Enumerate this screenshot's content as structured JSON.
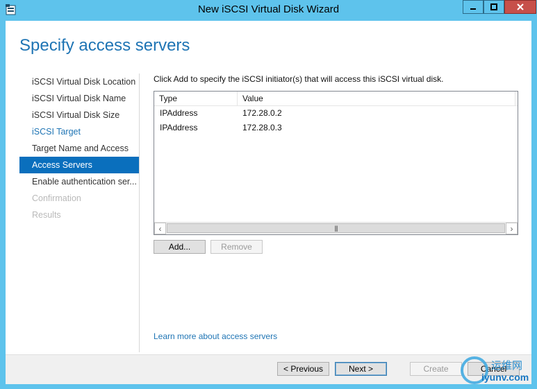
{
  "window": {
    "title": "New iSCSI Virtual Disk Wizard",
    "app_icon": "wizard-app-icon",
    "controls": [
      "minimize-icon",
      "maximize-icon",
      "close-icon"
    ]
  },
  "page": {
    "heading": "Specify access servers"
  },
  "nav": {
    "items": [
      {
        "label": "iSCSI Virtual Disk Location",
        "state": "normal"
      },
      {
        "label": "iSCSI Virtual Disk Name",
        "state": "normal"
      },
      {
        "label": "iSCSI Virtual Disk Size",
        "state": "normal"
      },
      {
        "label": "iSCSI Target",
        "state": "link"
      },
      {
        "label": "Target Name and Access",
        "state": "normal"
      },
      {
        "label": "Access Servers",
        "state": "active"
      },
      {
        "label": "Enable authentication ser...",
        "state": "normal"
      },
      {
        "label": "Confirmation",
        "state": "disabled"
      },
      {
        "label": "Results",
        "state": "disabled"
      }
    ]
  },
  "main": {
    "instruction": "Click Add to specify the iSCSI initiator(s) that will access this iSCSI virtual disk.",
    "table": {
      "columns": [
        "Type",
        "Value"
      ],
      "rows": [
        {
          "type": "IPAddress",
          "value": "172.28.0.2"
        },
        {
          "type": "IPAddress",
          "value": "172.28.0.3"
        }
      ]
    },
    "add_label": "Add...",
    "remove_label": "Remove",
    "learn_more": "Learn more about access servers"
  },
  "footer": {
    "previous_label": "< Previous",
    "next_label": "Next >",
    "create_label": "Create",
    "cancel_label": "Cancel"
  },
  "watermark": {
    "cn_text": "运维网",
    "domain": "iyunv.com"
  },
  "colors": {
    "titlebar": "#5ec3ec",
    "accent": "#1e74b4",
    "nav_active": "#0a6fbd",
    "close_button": "#c7504a"
  }
}
